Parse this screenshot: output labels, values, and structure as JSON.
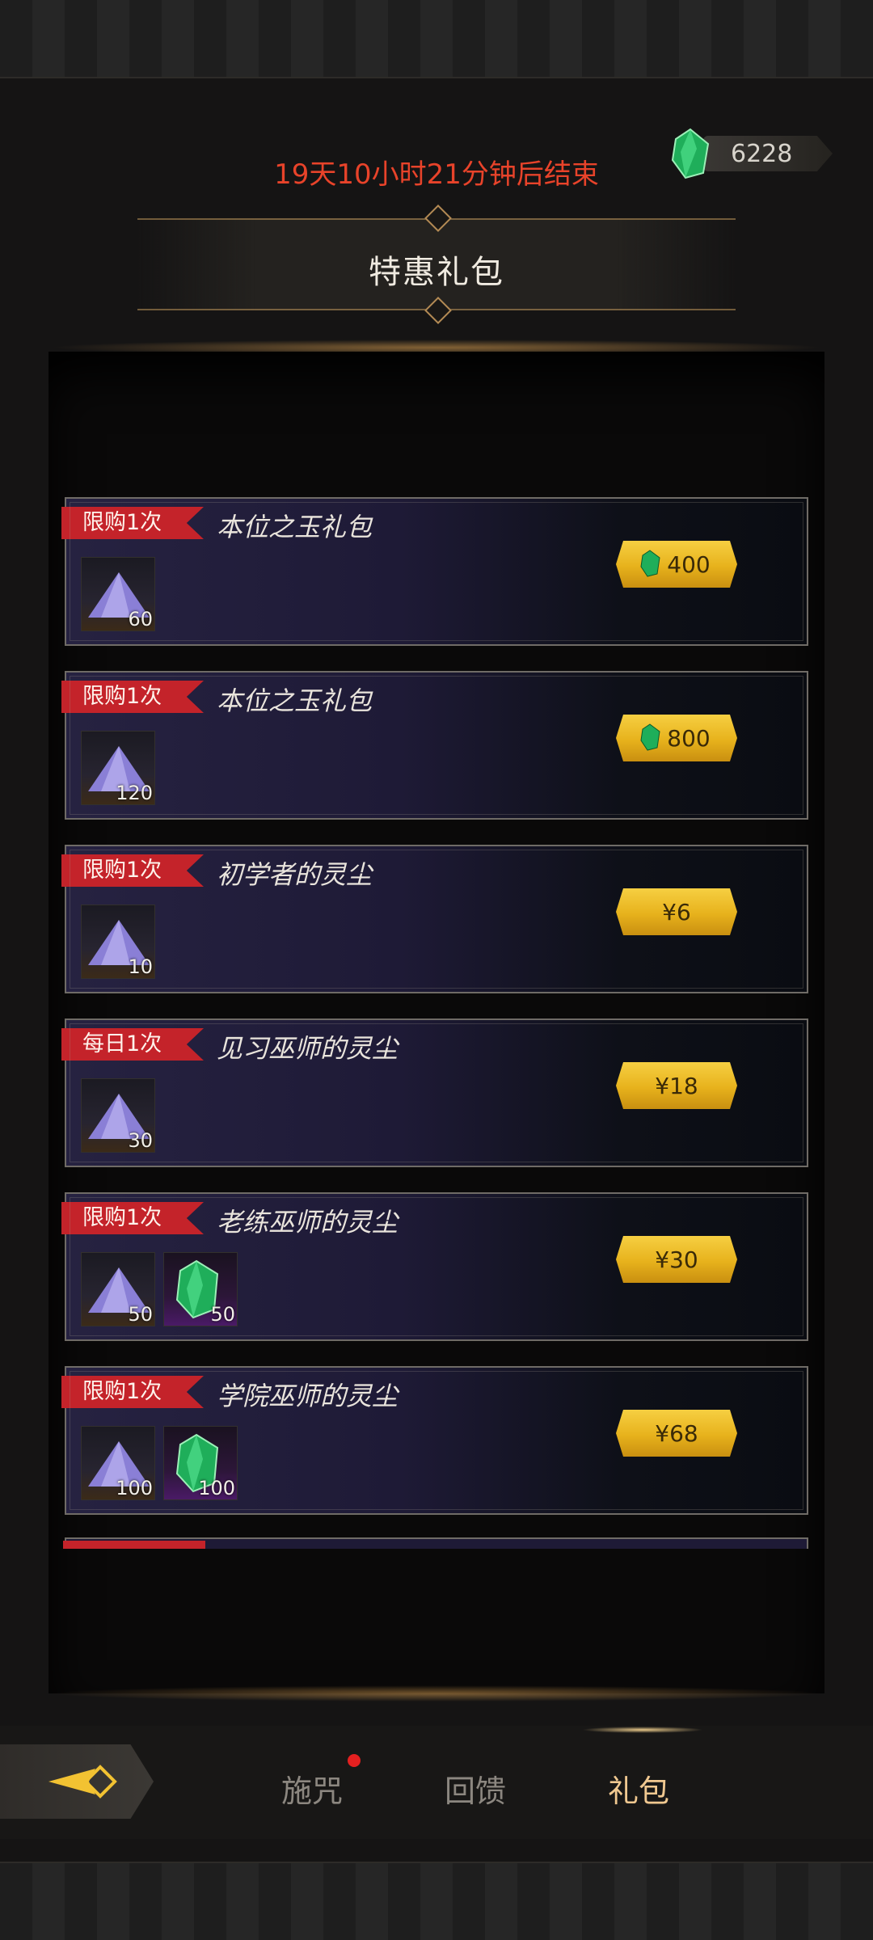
{
  "header": {
    "timer_text": "19天10小时21分钟后结束",
    "currency_value": "6228",
    "currency_icon": "green-gem-icon",
    "title": "特惠礼包"
  },
  "packs": [
    {
      "tag": "限购1次",
      "name": "本位之玉礼包",
      "items": [
        {
          "icon": "purple-dust-icon",
          "qty": "60"
        }
      ],
      "price": "400",
      "price_icon": "green-gem-icon"
    },
    {
      "tag": "限购1次",
      "name": "本位之玉礼包",
      "items": [
        {
          "icon": "purple-dust-icon",
          "qty": "120"
        }
      ],
      "price": "800",
      "price_icon": "green-gem-icon"
    },
    {
      "tag": "限购1次",
      "name": "初学者的灵尘",
      "items": [
        {
          "icon": "purple-dust-icon",
          "qty": "10"
        }
      ],
      "price": "¥6"
    },
    {
      "tag": "每日1次",
      "name": "见习巫师的灵尘",
      "items": [
        {
          "icon": "purple-dust-icon",
          "qty": "30"
        }
      ],
      "price": "¥18"
    },
    {
      "tag": "限购1次",
      "name": "老练巫师的灵尘",
      "items": [
        {
          "icon": "purple-dust-icon",
          "qty": "50"
        },
        {
          "icon": "green-gem-icon",
          "qty": "50"
        }
      ],
      "price": "¥30"
    },
    {
      "tag": "限购1次",
      "name": "学院巫师的灵尘",
      "items": [
        {
          "icon": "purple-dust-icon",
          "qty": "100"
        },
        {
          "icon": "green-gem-icon",
          "qty": "100"
        }
      ],
      "price": "¥68"
    }
  ],
  "nav": {
    "back_icon": "back-arrow-icon",
    "tabs": [
      {
        "label": "施咒",
        "has_badge": true
      },
      {
        "label": "回馈"
      },
      {
        "label": "礼包",
        "active": true
      }
    ]
  },
  "colors": {
    "accent_red": "#e8432a",
    "tag_red": "#c4232a",
    "gold": "#f2c232",
    "active_tab": "#f0c890"
  }
}
